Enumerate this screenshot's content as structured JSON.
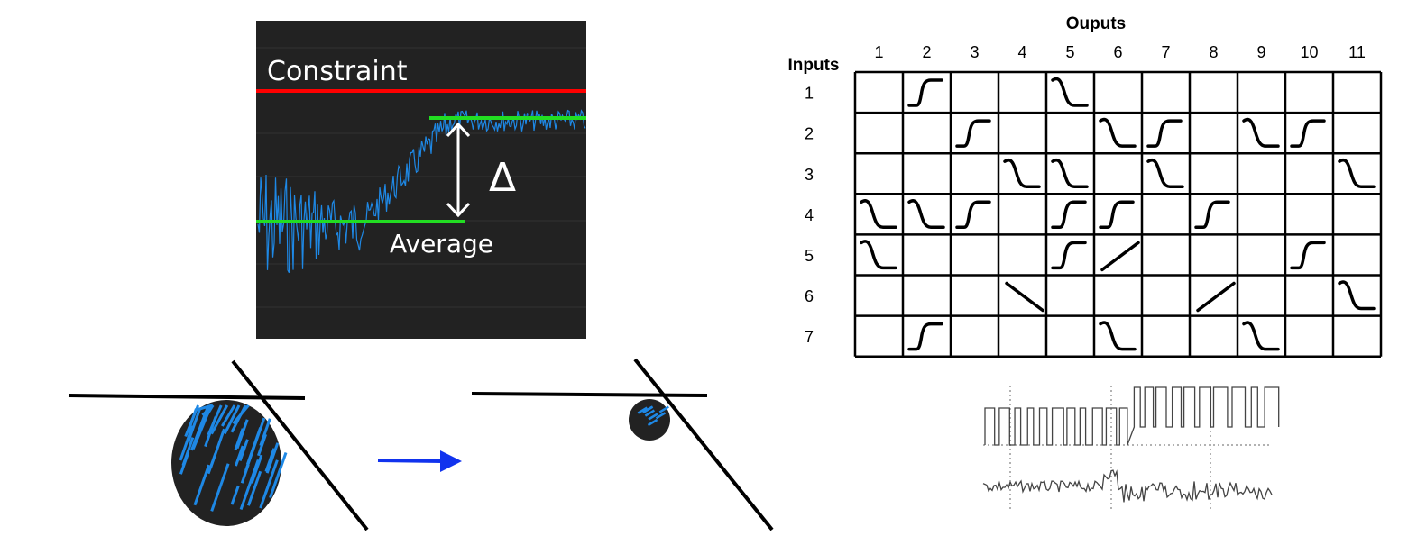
{
  "signal_panel": {
    "constraint_label": "Constraint",
    "average_label": "Average",
    "delta_label": "Δ",
    "background_color": "#222222",
    "constraint_color": "#ff0000",
    "average_color": "#22dd22",
    "signal_color": "#1e88e5"
  },
  "tuning_diagram": {
    "arrow_color": "#1133ee",
    "blob_color": "#1e88e5"
  },
  "io_grid": {
    "outputs_title": "Ouputs",
    "inputs_title": "Inputs",
    "output_numbers": [
      "1",
      "2",
      "3",
      "4",
      "5",
      "6",
      "7",
      "8",
      "9",
      "10",
      "11"
    ],
    "input_numbers": [
      "1",
      "2",
      "3",
      "4",
      "5",
      "6",
      "7"
    ],
    "cells": [
      [
        "",
        "rise",
        "",
        "",
        "fall",
        "",
        "",
        "",
        "",
        "",
        ""
      ],
      [
        "",
        "",
        "rise",
        "",
        "",
        "fall",
        "rise",
        "",
        "fall",
        "rise",
        ""
      ],
      [
        "",
        "",
        "",
        "fall",
        "fall",
        "",
        "fall",
        "",
        "",
        "",
        "fall"
      ],
      [
        "fall",
        "fall",
        "rise",
        "",
        "rise",
        "rise",
        "",
        "rise",
        "",
        "",
        ""
      ],
      [
        "fall",
        "",
        "",
        "",
        "rise",
        "line-up",
        "",
        "",
        "",
        "rise",
        ""
      ],
      [
        "",
        "",
        "",
        "line-down",
        "",
        "",
        "",
        "line-up",
        "",
        "",
        "fall"
      ],
      [
        "",
        "rise",
        "",
        "",
        "",
        "fall",
        "",
        "",
        "fall",
        "",
        ""
      ]
    ]
  }
}
